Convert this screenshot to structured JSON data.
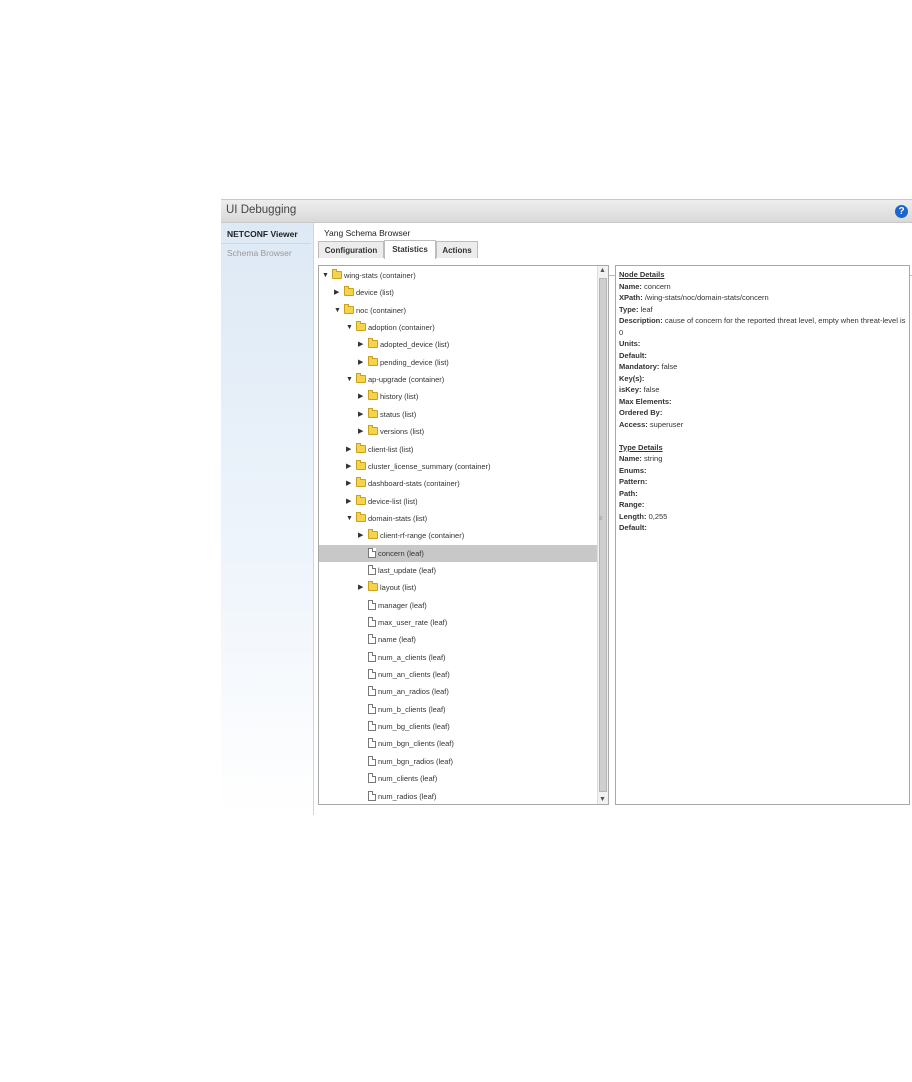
{
  "panel": {
    "title": "UI Debugging",
    "help_icon": "?"
  },
  "sidebar": {
    "items": [
      {
        "label": "NETCONF Viewer",
        "active": true
      },
      {
        "label": "Schema Browser",
        "active": false
      }
    ]
  },
  "main": {
    "title": "Yang Schema Browser",
    "tabs": [
      {
        "label": "Configuration",
        "selected": false
      },
      {
        "label": "Statistics",
        "selected": true
      },
      {
        "label": "Actions",
        "selected": false
      }
    ]
  },
  "tree": {
    "rows": [
      {
        "label": "wing-stats (container)",
        "depth": 0,
        "type": "folder",
        "expanded": true
      },
      {
        "label": "device (list)",
        "depth": 1,
        "type": "folder",
        "expanded": false
      },
      {
        "label": "noc (container)",
        "depth": 1,
        "type": "folder",
        "expanded": true
      },
      {
        "label": "adoption (container)",
        "depth": 2,
        "type": "folder",
        "expanded": true
      },
      {
        "label": "adopted_device (list)",
        "depth": 3,
        "type": "folder",
        "expanded": false
      },
      {
        "label": "pending_device (list)",
        "depth": 3,
        "type": "folder",
        "expanded": false
      },
      {
        "label": "ap-upgrade (container)",
        "depth": 2,
        "type": "folder",
        "expanded": true
      },
      {
        "label": "history (list)",
        "depth": 3,
        "type": "folder",
        "expanded": false
      },
      {
        "label": "status (list)",
        "depth": 3,
        "type": "folder",
        "expanded": false
      },
      {
        "label": "versions (list)",
        "depth": 3,
        "type": "folder",
        "expanded": false
      },
      {
        "label": "client-list (list)",
        "depth": 2,
        "type": "folder",
        "expanded": false
      },
      {
        "label": "cluster_license_summary (container)",
        "depth": 2,
        "type": "folder",
        "expanded": false
      },
      {
        "label": "dashboard-stats (container)",
        "depth": 2,
        "type": "folder",
        "expanded": false
      },
      {
        "label": "device-list (list)",
        "depth": 2,
        "type": "folder",
        "expanded": false
      },
      {
        "label": "domain-stats (list)",
        "depth": 2,
        "type": "folder",
        "expanded": true
      },
      {
        "label": "client-rf-range (container)",
        "depth": 3,
        "type": "folder",
        "expanded": false
      },
      {
        "label": "concern (leaf)",
        "depth": 3,
        "type": "file",
        "selected": true
      },
      {
        "label": "last_update (leaf)",
        "depth": 3,
        "type": "file"
      },
      {
        "label": "layout (list)",
        "depth": 3,
        "type": "folder",
        "expanded": false
      },
      {
        "label": "manager (leaf)",
        "depth": 3,
        "type": "file"
      },
      {
        "label": "max_user_rate (leaf)",
        "depth": 3,
        "type": "file"
      },
      {
        "label": "name (leaf)",
        "depth": 3,
        "type": "file"
      },
      {
        "label": "num_a_clients (leaf)",
        "depth": 3,
        "type": "file"
      },
      {
        "label": "num_an_clients (leaf)",
        "depth": 3,
        "type": "file"
      },
      {
        "label": "num_an_radios (leaf)",
        "depth": 3,
        "type": "file"
      },
      {
        "label": "num_b_clients (leaf)",
        "depth": 3,
        "type": "file"
      },
      {
        "label": "num_bg_clients (leaf)",
        "depth": 3,
        "type": "file"
      },
      {
        "label": "num_bgn_clients (leaf)",
        "depth": 3,
        "type": "file"
      },
      {
        "label": "num_bgn_radios (leaf)",
        "depth": 3,
        "type": "file"
      },
      {
        "label": "num_clients (leaf)",
        "depth": 3,
        "type": "file"
      },
      {
        "label": "num_radios (leaf)",
        "depth": 3,
        "type": "file"
      }
    ]
  },
  "details": {
    "node_heading": "Node Details",
    "node": [
      {
        "key": "Name:",
        "value": " concern"
      },
      {
        "key": "XPath:",
        "value": " /wing-stats/noc/domain-stats/concern"
      },
      {
        "key": "Type:",
        "value": " leaf"
      },
      {
        "key": "Description:",
        "value": " cause of concern for the reported threat level, empty when threat-level is 0"
      },
      {
        "key": "Units:",
        "value": ""
      },
      {
        "key": "Default:",
        "value": ""
      },
      {
        "key": "Mandatory:",
        "value": " false"
      },
      {
        "key": "Key(s):",
        "value": ""
      },
      {
        "key": "isKey:",
        "value": " false"
      },
      {
        "key": "Max Elements:",
        "value": ""
      },
      {
        "key": "Ordered By:",
        "value": ""
      },
      {
        "key": "Access:",
        "value": " superuser"
      }
    ],
    "type_heading": "Type Details",
    "type": [
      {
        "key": "Name:",
        "value": " string"
      },
      {
        "key": "Enums:",
        "value": ""
      },
      {
        "key": "Pattern:",
        "value": ""
      },
      {
        "key": "Path:",
        "value": ""
      },
      {
        "key": "Range:",
        "value": ""
      },
      {
        "key": "Length:",
        "value": " 0,255"
      },
      {
        "key": "Default:",
        "value": ""
      }
    ]
  }
}
